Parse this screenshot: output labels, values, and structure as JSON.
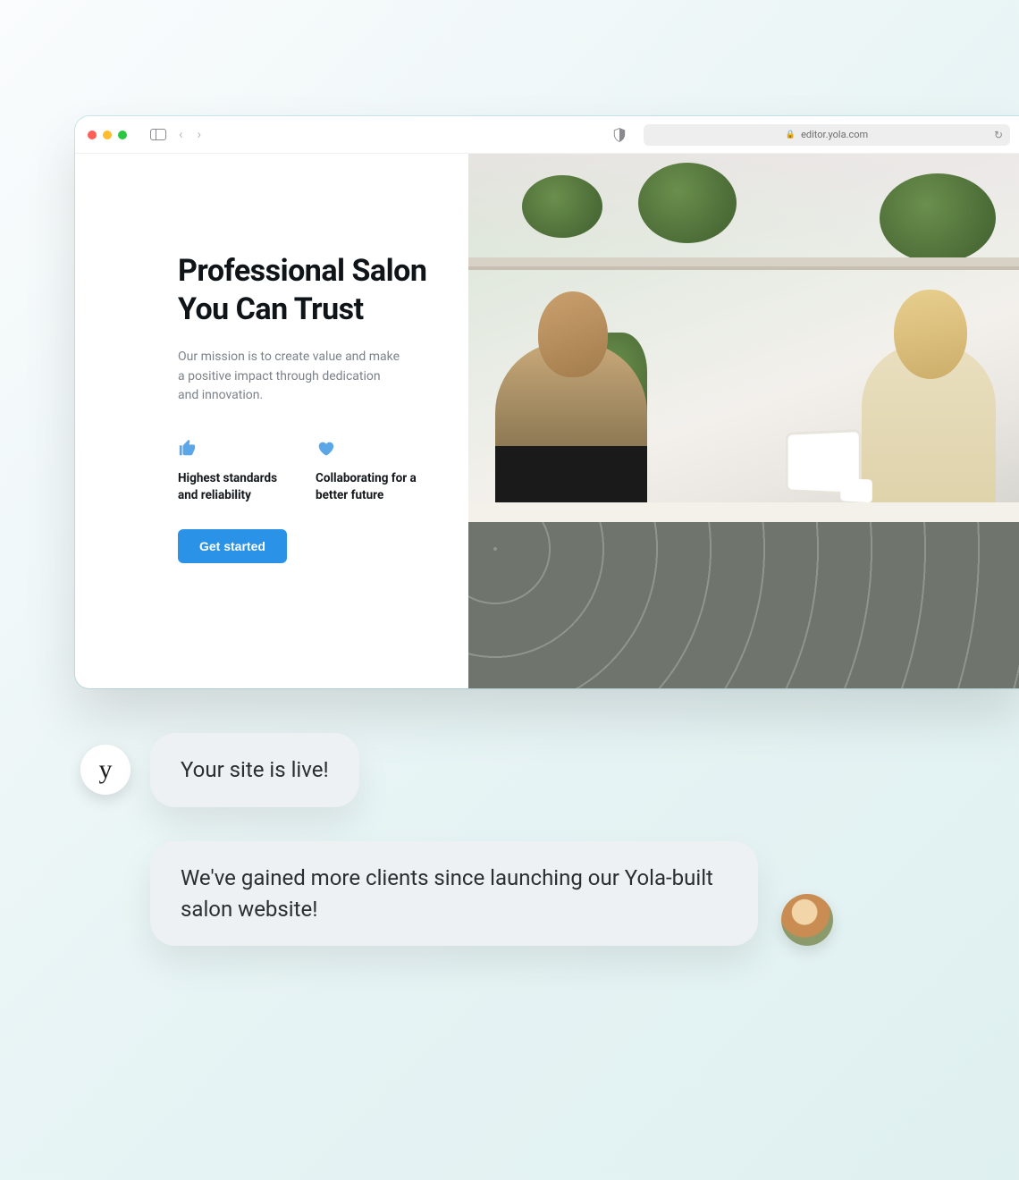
{
  "browser": {
    "url": "editor.yola.com"
  },
  "site": {
    "heading": "Professional Salon You Can Trust",
    "mission": "Our mission is to create value and make a positive impact through dedication and innovation.",
    "features": [
      {
        "icon": "thumbs-up-icon",
        "text": "Highest standards and reliability"
      },
      {
        "icon": "heart-icon",
        "text": "Collaborating for a better future"
      }
    ],
    "cta_label": "Get started"
  },
  "chat": {
    "system_avatar_letter": "y",
    "msg1": "Your site is live!",
    "msg2": "We've gained more clients since launching our Yola-built salon website!"
  }
}
